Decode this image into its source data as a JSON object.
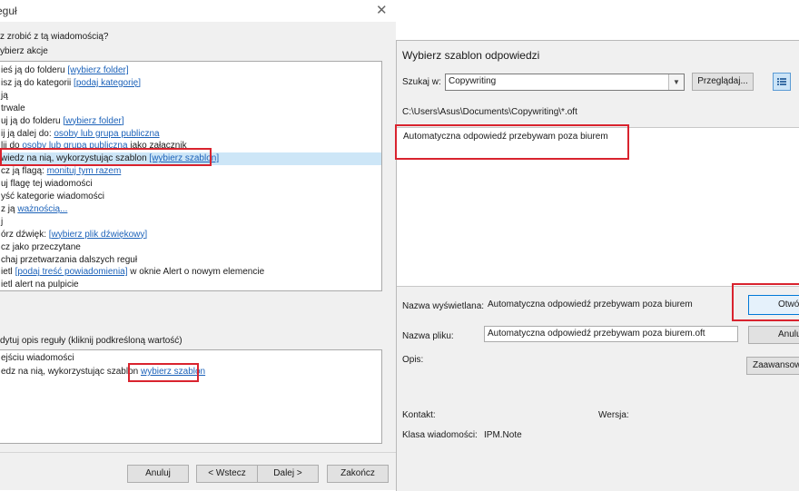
{
  "rules_dialog": {
    "title": "eguł",
    "close_glyph": "✕",
    "question": "z zrobić z tą wiadomością?",
    "step1_label": "ybierz akcje",
    "actions": [
      {
        "text": "ieś ją do folderu ",
        "link": "[wybierz folder]",
        "after": ""
      },
      {
        "text": "isz ją do kategorii ",
        "link": "[podaj kategorię]",
        "after": ""
      },
      {
        "text": "ją",
        "link": "",
        "after": ""
      },
      {
        "text": "trwale",
        "link": "",
        "after": ""
      },
      {
        "text": "uj ją do folderu ",
        "link": "[wybierz folder]",
        "after": ""
      },
      {
        "text": "ij ją dalej do: ",
        "link": "osoby lub grupa publiczna",
        "after": ""
      },
      {
        "text": "lij do ",
        "link": "osoby lub grupa publiczna",
        "after": " jako załącznik"
      },
      {
        "text": "wiedz na nią, wykorzystując szablon ",
        "link": "[wybierz szablon]",
        "after": ""
      },
      {
        "text": "cz ją flagą: ",
        "link": "monituj tym razem",
        "after": ""
      },
      {
        "text": "uj flagę tej wiadomości",
        "link": "",
        "after": ""
      },
      {
        "text": "yść kategorie wiadomości",
        "link": "",
        "after": ""
      },
      {
        "text": "z ją ",
        "link": "ważnością...",
        "after": ""
      },
      {
        "text": "j",
        "link": "",
        "after": ""
      },
      {
        "text": "órz dźwięk: ",
        "link": "[wybierz plik dźwiękowy]",
        "after": ""
      },
      {
        "text": "cz jako przeczytane",
        "link": "",
        "after": ""
      },
      {
        "text": "chaj przetwarzania dalszych reguł",
        "link": "",
        "after": ""
      },
      {
        "text": "ietl ",
        "link": "[podaj treść powiadomienia]",
        "after": " w oknie Alert o nowym elemencie"
      },
      {
        "text": "ietl alert na pulpicie",
        "link": "",
        "after": ""
      }
    ],
    "selected_index": 7,
    "step2_label": "dytuj opis reguły (kliknij podkreśloną wartość)",
    "desc_line1": "ejściu wiadomości",
    "desc_line2_text": "edz na nią, wykorzystując szablon ",
    "desc_line2_link": "wybierz szablon",
    "buttons": {
      "cancel": "Anuluj",
      "back": "< Wstecz",
      "next": "Dalej >",
      "finish": "Zakończ"
    }
  },
  "template_dialog": {
    "title": "Wybierz szablon odpowiedzi",
    "look_in_label": "Szukaj w:",
    "look_in_value": "Copywriting",
    "browse_button": "Przeglądaj...",
    "path": "C:\\Users\\Asus\\Documents\\Copywriting\\*.oft",
    "file_item": "Automatyczna odpowiedź przebywam poza biurem",
    "display_name_label": "Nazwa wyświetlana:",
    "display_name_value": "Automatyczna odpowiedź przebywam poza biurem",
    "file_name_label": "Nazwa pliku:",
    "file_name_value": "Automatyczna odpowiedź przebywam poza biurem.oft",
    "description_label": "Opis:",
    "contact_label": "Kontakt:",
    "version_label": "Wersja:",
    "message_class_label": "Klasa wiadomości:",
    "message_class_value": "IPM.Note",
    "open_button": "Otwór",
    "cancel_button": "Anulu",
    "advanced_button": "Zaawansowa"
  },
  "colors": {
    "highlight": "#d9232e",
    "selection": "#cde6f7",
    "link": "#1c62b9"
  }
}
